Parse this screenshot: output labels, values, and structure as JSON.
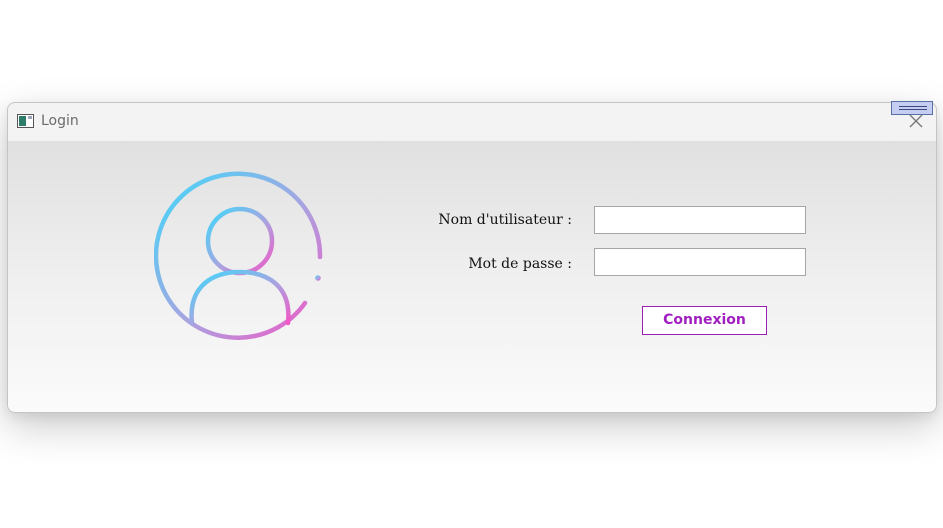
{
  "window": {
    "title": "Login",
    "title_color": "#6b6b6b",
    "chrome_background": "#f3f3f3"
  },
  "titlebar": {
    "app_icon": "window-app-icon",
    "close_icon": "close-icon",
    "menu_icon": "hamburger-menu-icon"
  },
  "avatar": {
    "icon": "user-avatar-icon",
    "gradient_start": "#3fd9fb",
    "gradient_mid": "#a9a3e0",
    "gradient_end": "#f257c6"
  },
  "form": {
    "username_label": "Nom d'utilisateur :",
    "username_value": "",
    "password_label": "Mot de passe :",
    "password_value": "",
    "submit_label": "Connexion",
    "submit_color": "#a11ec0"
  }
}
